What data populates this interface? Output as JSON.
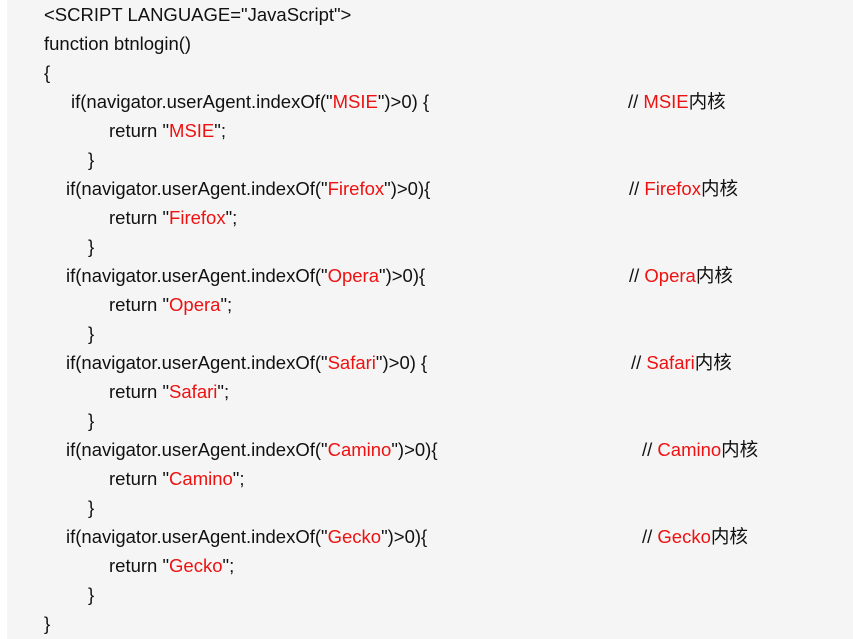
{
  "code": {
    "script_tag": "<SCRIPT LANGUAGE=\"JavaScript\">",
    "function_decl": "function btnlogin()",
    "open_brace": "{",
    "close_brace": "}",
    "blocks": [
      {
        "if_pre": "if(navigator.userAgent.indexOf(\"",
        "name": "MSIE",
        "if_post": "\")>0) {",
        "ret_pre": "return \"",
        "ret_post": "\";",
        "cm_pre": "// ",
        "cm_suf": "内核",
        "close": "}"
      },
      {
        "if_pre": "if(navigator.userAgent.indexOf(\"",
        "name": "Firefox",
        "if_post": "\")>0){",
        "ret_pre": "return \"",
        "ret_post": "\";",
        "cm_pre": "// ",
        "cm_suf": "内核",
        "close": "}"
      },
      {
        "if_pre": "if(navigator.userAgent.indexOf(\"",
        "name": "Opera",
        "if_post": "\")>0){",
        "ret_pre": "return \"",
        "ret_post": "\";",
        "cm_pre": "// ",
        "cm_suf": "内核",
        "close": "}"
      },
      {
        "if_pre": "if(navigator.userAgent.indexOf(\"",
        "name": "Safari",
        "if_post": "\")>0) {",
        "ret_pre": "return \"",
        "ret_post": "\";",
        "cm_pre": "// ",
        "cm_suf": "内核",
        "close": "}"
      },
      {
        "if_pre": "if(navigator.userAgent.indexOf(\"",
        "name": "Camino",
        "if_post": "\")>0){",
        "ret_pre": "return \"",
        "ret_post": "\";",
        "cm_pre": "// ",
        "cm_suf": "内核",
        "close": "}"
      },
      {
        "if_pre": "if(navigator.userAgent.indexOf(\"",
        "name": "Gecko",
        "if_post": "\")>0){",
        "ret_pre": "return \"",
        "ret_post": "\";",
        "cm_pre": "// ",
        "cm_suf": "内核",
        "close": "}"
      }
    ]
  },
  "colors": {
    "background": "#f5f5f5",
    "text": "#111111",
    "string_highlight": "#ee1111"
  }
}
